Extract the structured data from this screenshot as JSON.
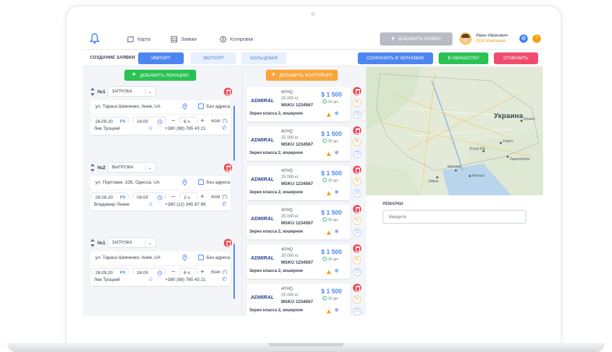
{
  "nav": {
    "map": "Карта",
    "orders": "Заявки",
    "quotes": "Котировки",
    "add_order": "ДОБАВИТЬ ЗАЯВКУ",
    "user_name": "Иван Иванович",
    "user_company": "ООО Компания"
  },
  "toolbar": {
    "title": "СОЗДАНИЕ ЗАЯВКИ",
    "tabs": [
      "ИМПОРТ",
      "ЭКСПОРТ",
      "КОЛЬЦЕВАЯ"
    ],
    "save_draft": "СОХРАНИТЬ В ЧЕРНОВИК",
    "to_processing": "В ОБРАБОТКУ",
    "cancel": "ОТМЕНИТЬ"
  },
  "left": {
    "add_location": "ДОБАВИТЬ ЛОКАЦИЮ",
    "locations": [
      {
        "num": "№1",
        "type": "ЗАГРУЗКА",
        "address": "ул. Тараса Шевченко, Киев, UA",
        "no_address": "Без адреса",
        "date": "26.09.20",
        "time": "16:00",
        "hours": "6 ч.",
        "vgm": "ВGМ",
        "person": "Лев Троцкий",
        "phone": "+380 (98) 765 43 21"
      },
      {
        "num": "№2",
        "type": "ВЫГРУЗКА",
        "address": "ул. Портовая, 32Б, Одесса, UA",
        "no_address": "Без адреса",
        "date": "28.09.20",
        "time": "09:00",
        "hours": "2 ч.",
        "vgm": "ВGМ",
        "person": "Владимир Ленин",
        "phone": "+380 (12) 345 67 89"
      },
      {
        "num": "№1",
        "type": "ЗАГРУЗКА",
        "address": "ул. Тараса Шевченко, Киев, UA",
        "no_address": "Без адреса",
        "date": "26.09.20",
        "time": "16:00",
        "hours": "6 ч.",
        "vgm": "ВGМ",
        "person": "Лев Троцкий",
        "phone": "+380 (98) 765 43 21"
      }
    ]
  },
  "mid": {
    "add_container": "ДОБАВИТЬ КОНТЕЙНЕР",
    "containers": [
      {
        "logo": "ADMIRAL",
        "type": "40'HQ",
        "weight": "25 000 кг.",
        "msku": "MSKU 1234567",
        "price": "$ 1 500",
        "days": "32 дн.",
        "cargo": "Зерно класса 2, кошерное"
      },
      {
        "logo": "ADMIRAL",
        "type": "40'HQ",
        "weight": "25 000 кг.",
        "msku": "MSKU 1234567",
        "price": "$ 1 500",
        "days": "32 дн.",
        "cargo": "Зерно класса 2, кошерное"
      },
      {
        "logo": "ADMIRAL",
        "type": "40'HQ",
        "weight": "25 000 кг.",
        "msku": "MSKU 1234567",
        "price": "$ 1 500",
        "days": "32 дн.",
        "cargo": "Зерно класса 2, кошерное"
      },
      {
        "logo": "ADMIRAL",
        "type": "40'HQ",
        "weight": "25 000 кг.",
        "msku": "MSKU 1234567",
        "price": "$ 1 500",
        "days": "32 дн.",
        "cargo": "Зерно класса 2, кошерное"
      },
      {
        "logo": "ADMIRAL",
        "type": "40'HQ",
        "weight": "25 000 кг.",
        "msku": "MSKU 1234567",
        "price": "$ 1 500",
        "days": "32 дн.",
        "cargo": "Зерно класса 2, кошерное"
      },
      {
        "logo": "ADMIRAL",
        "type": "40'HQ",
        "weight": "25 000 кг.",
        "msku": "MSKU 1234567",
        "price": "$ 1 500",
        "days": "32 дн.",
        "cargo": "Зерно класса 2, кошерное"
      }
    ]
  },
  "map": {
    "country": "Украина",
    "cities": [
      "Kharkiv",
      "Dnipro",
      "Kryvyi Rih",
      "Zaporizhzhia",
      "Mykolaiv",
      "Kherson",
      "Odesa"
    ]
  },
  "remarks": {
    "title": "РЕМАРКИ",
    "placeholder": "Введите"
  },
  "colors": {
    "primary": "#4d86f0",
    "success": "#2bc254",
    "danger": "#ef4c5b",
    "warning": "#f8a63c"
  }
}
